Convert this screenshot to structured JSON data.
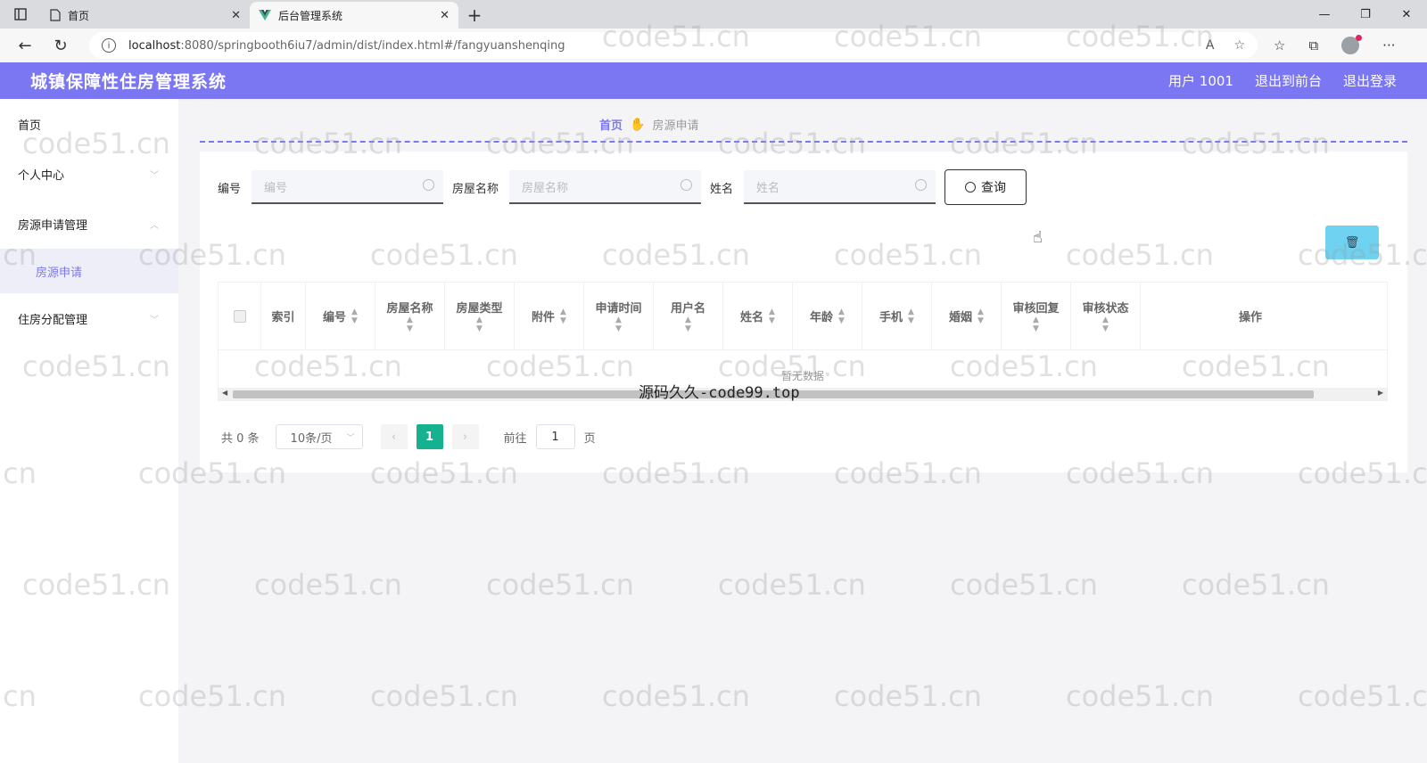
{
  "browser": {
    "tabs": [
      {
        "title": "首页",
        "active": false
      },
      {
        "title": "后台管理系统",
        "active": true
      }
    ],
    "url_host": "localhost",
    "url_path": ":8080/springbooth6iu7/admin/dist/index.html#/fangyuanshenqing"
  },
  "header": {
    "title": "城镇保障性住房管理系统",
    "user": "用户 1001",
    "to_front": "退出到前台",
    "logout": "退出登录",
    "accent": "#7b77f2"
  },
  "sidebar": {
    "items": [
      {
        "label": "首页"
      },
      {
        "label": "个人中心"
      },
      {
        "label": "房源申请管理"
      },
      {
        "label": "房源申请"
      },
      {
        "label": "住房分配管理"
      }
    ]
  },
  "breadcrumb": {
    "home": "首页",
    "current": "房源申请"
  },
  "search": {
    "field1_label": "编号",
    "field1_placeholder": "编号",
    "field2_label": "房屋名称",
    "field2_placeholder": "房屋名称",
    "field3_label": "姓名",
    "field3_placeholder": "姓名",
    "button": "查询"
  },
  "table": {
    "columns": [
      "索引",
      "编号",
      "房屋名称",
      "房屋类型",
      "附件",
      "申请时间",
      "用户名",
      "姓名",
      "年龄",
      "手机",
      "婚姻",
      "审核回复",
      "审核状态",
      "操作"
    ],
    "empty_text": "暂无数据"
  },
  "pager": {
    "total": "共 0 条",
    "page_size": "10条/页",
    "current": "1",
    "goto_label": "前往",
    "goto_value": "1",
    "page_suffix": "页",
    "active_color": "#16b28f"
  },
  "overlay": {
    "text": "源码久久-code99.top"
  },
  "watermark": {
    "text": "code51.cn"
  }
}
